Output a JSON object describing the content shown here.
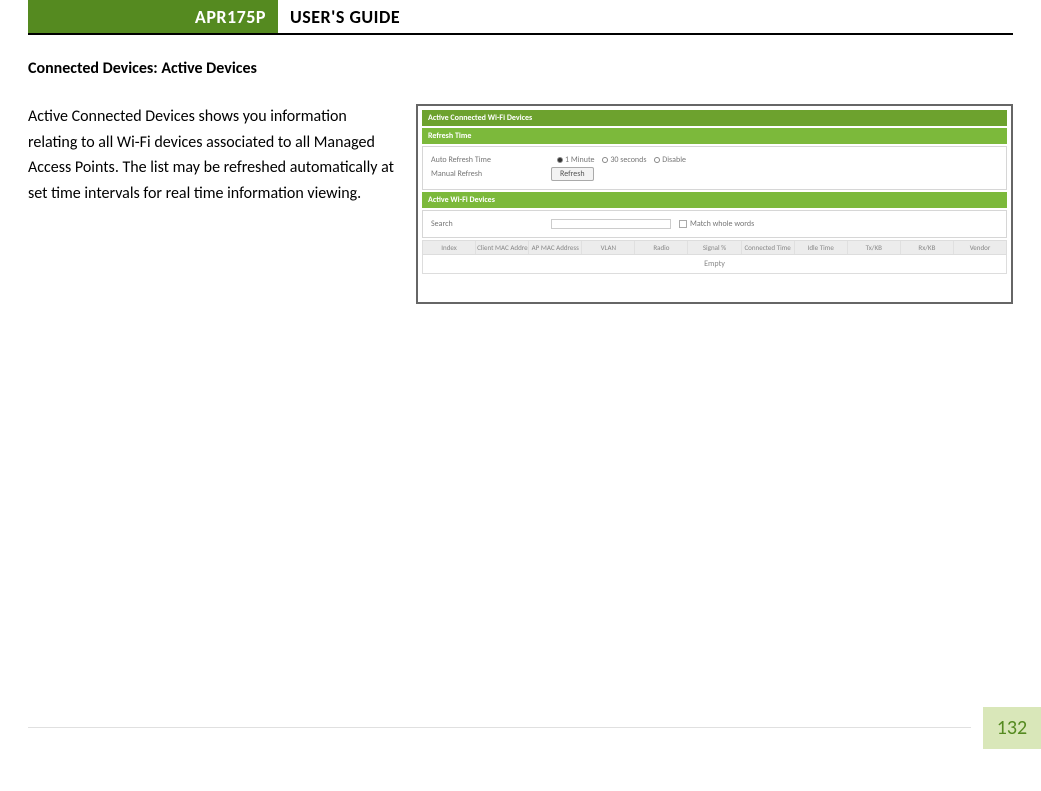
{
  "header": {
    "model": "APR175P",
    "title": "USER'S GUIDE"
  },
  "section_heading": "Connected Devices: Active Devices",
  "body_text": "Active Connected Devices shows you information relating to all Wi-Fi devices associated to all Managed Access Points. The list may be refreshed automatically at set time intervals for real time information viewing.",
  "screenshot": {
    "title_bar": "Active Connected Wi-Fi Devices",
    "refresh_section": {
      "header": "Refresh Time",
      "auto_label": "Auto Refresh Time",
      "manual_label": "Manual Refresh",
      "options": {
        "o1": "1 Minute",
        "o2": "30 seconds",
        "o3": "Disable"
      },
      "button": "Refresh"
    },
    "devices_section": {
      "header": "Active Wi-Fi Devices",
      "search_label": "Search",
      "match_label": "Match whole words",
      "columns": {
        "c0": "Index",
        "c1": "Client MAC Address",
        "c2": "AP MAC Address",
        "c3": "VLAN",
        "c4": "Radio",
        "c5": "Signal %",
        "c6": "Connected Time",
        "c7": "Idle Time",
        "c8": "Tx/KB",
        "c9": "Rx/KB",
        "c10": "Vendor"
      },
      "empty": "Empty"
    }
  },
  "page_number": "132"
}
